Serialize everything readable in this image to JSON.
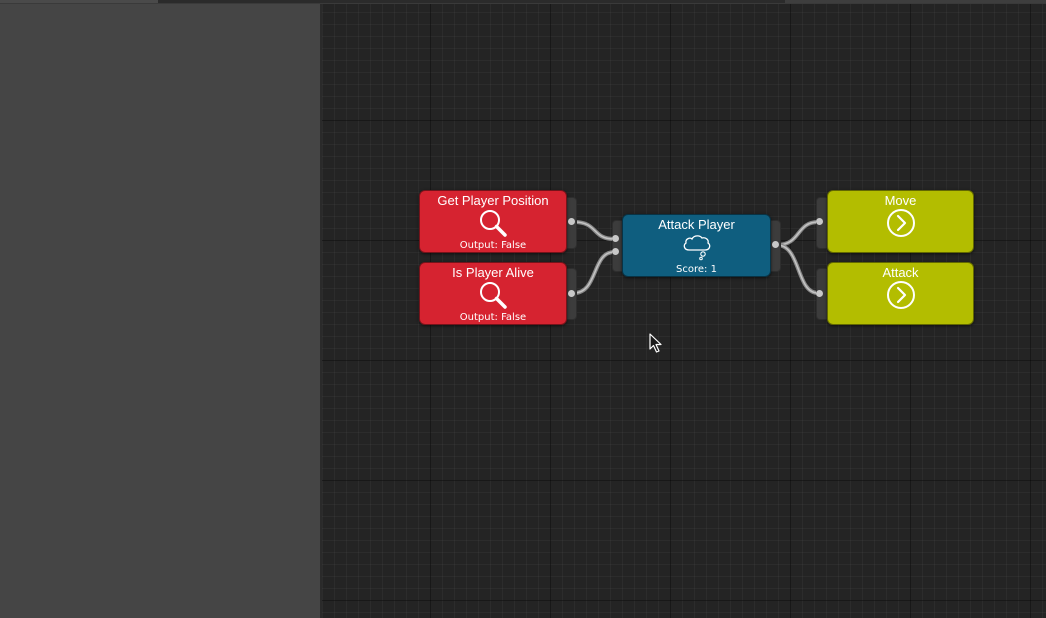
{
  "nodes": {
    "get_player_position": {
      "title": "Get Player Position",
      "output": "Output: False",
      "icon": "magnifier-icon",
      "color": "#d62330"
    },
    "is_player_alive": {
      "title": "Is Player Alive",
      "output": "Output: False",
      "icon": "magnifier-icon",
      "color": "#d62330"
    },
    "attack_player": {
      "title": "Attack Player",
      "score": "Score: 1",
      "icon": "thought-bubble-icon",
      "color": "#0f5e7f"
    },
    "move": {
      "title": "Move",
      "icon": "arrow-circle-icon",
      "color": "#b3bd00"
    },
    "attack": {
      "title": "Attack",
      "icon": "arrow-circle-icon",
      "color": "#b3bd00"
    }
  },
  "connections": [
    {
      "from": "get_player_position",
      "to": "attack_player"
    },
    {
      "from": "is_player_alive",
      "to": "attack_player"
    },
    {
      "from": "attack_player",
      "to": "move"
    },
    {
      "from": "attack_player",
      "to": "attack"
    }
  ]
}
